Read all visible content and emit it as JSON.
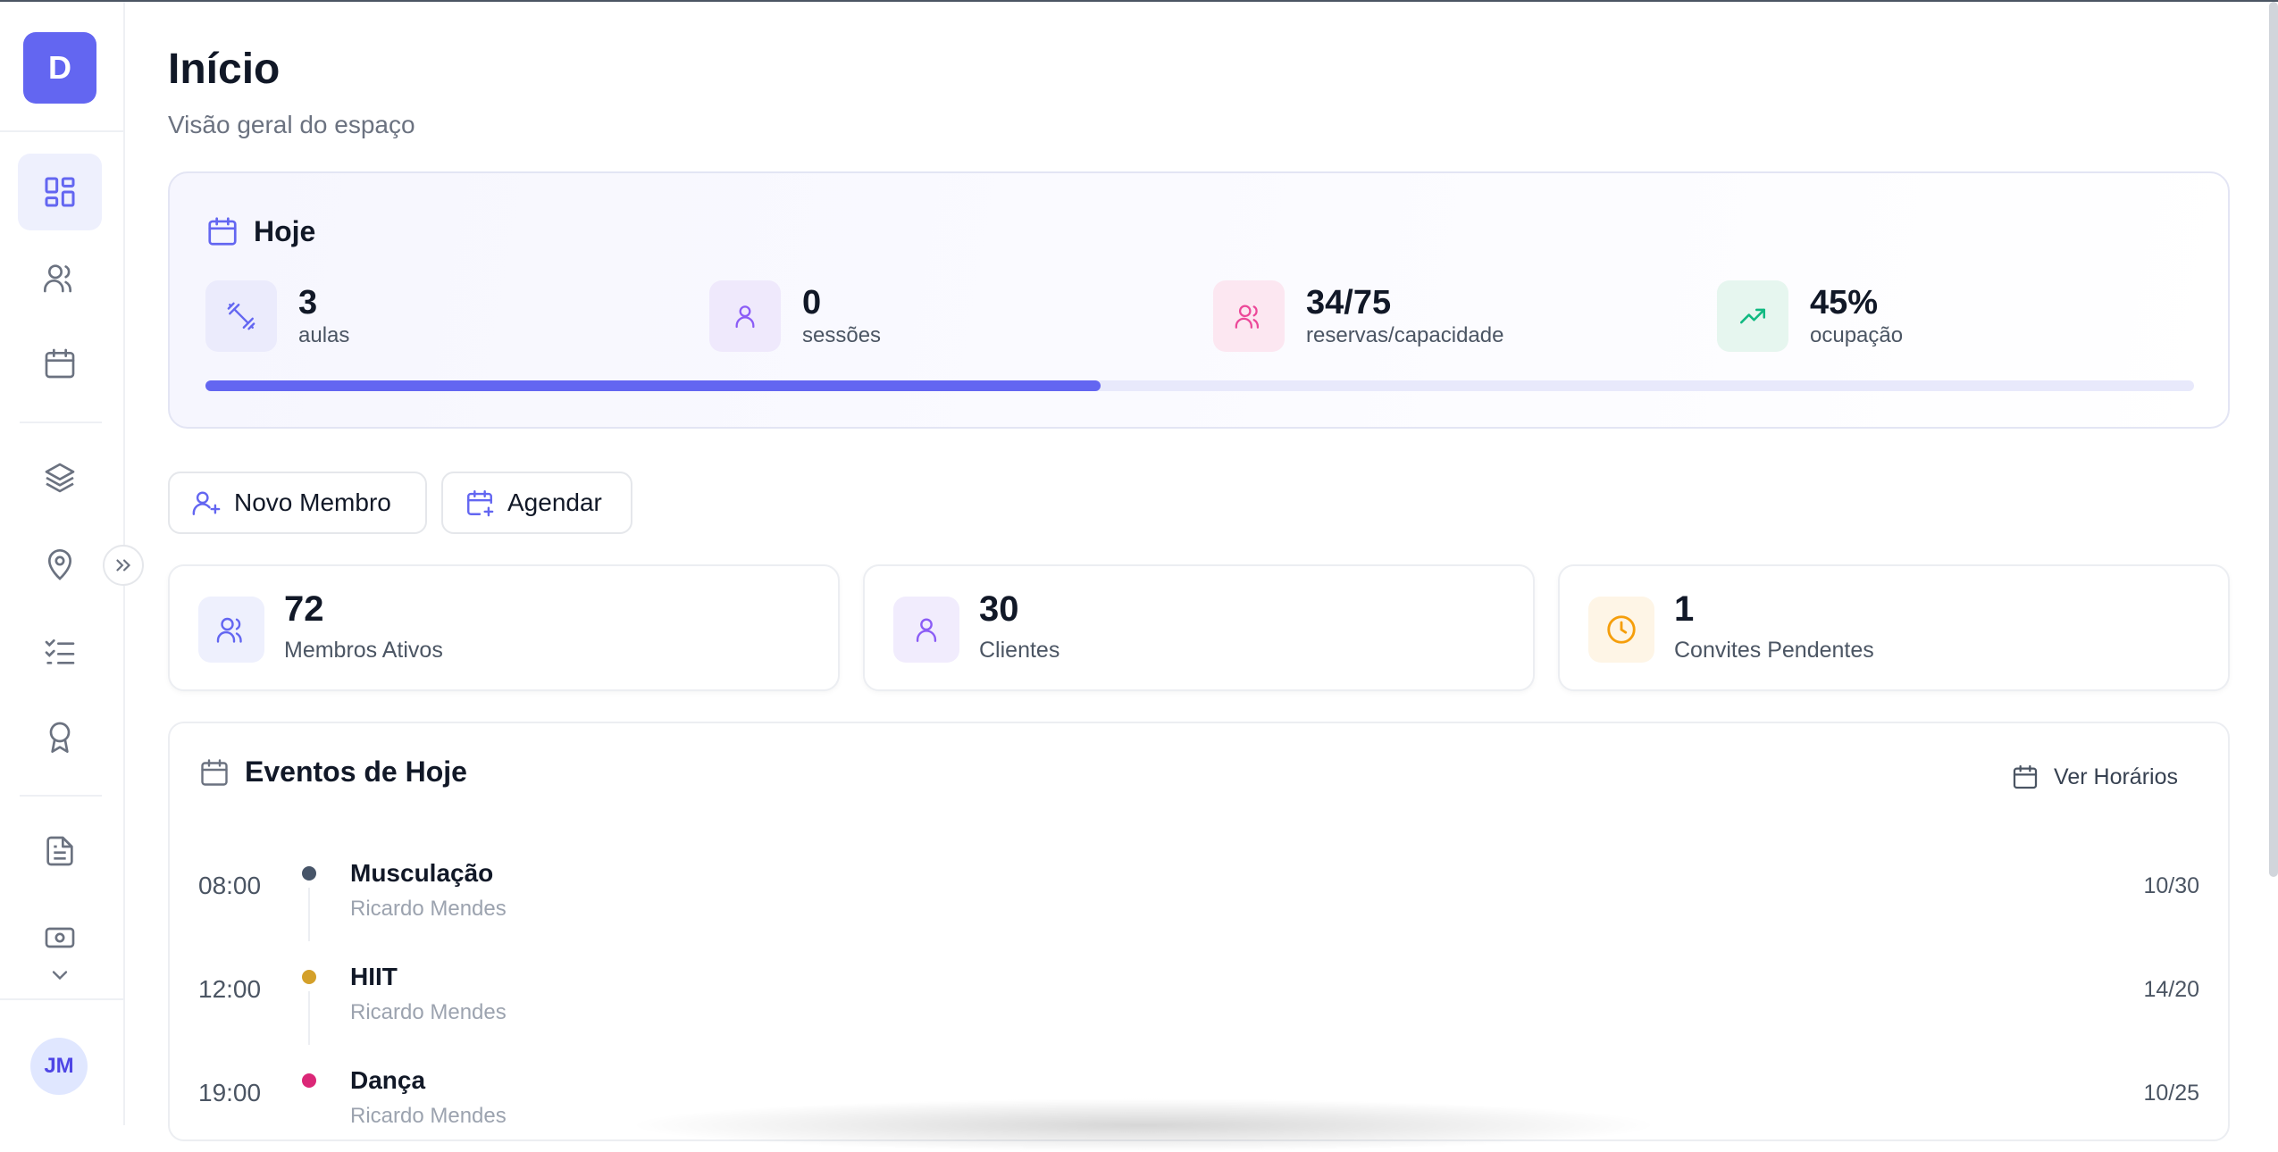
{
  "sidebar": {
    "logo_letter": "D",
    "items": [
      {
        "name": "dashboard",
        "icon": "dashboard-icon",
        "active": true
      },
      {
        "name": "members",
        "icon": "users-icon"
      },
      {
        "name": "schedule",
        "icon": "calendar-icon"
      },
      {
        "name": "plans",
        "icon": "layers-icon"
      },
      {
        "name": "locations",
        "icon": "map-pin-icon"
      },
      {
        "name": "tasks",
        "icon": "checklist-icon"
      },
      {
        "name": "achievements",
        "icon": "award-icon"
      },
      {
        "name": "documents",
        "icon": "file-text-icon"
      },
      {
        "name": "payments",
        "icon": "banknote-icon"
      }
    ],
    "user_initials": "JM"
  },
  "header": {
    "title": "Início",
    "subtitle": "Visão geral do espaço"
  },
  "today": {
    "title": "Hoje",
    "stats": [
      {
        "value": "3",
        "label": "aulas",
        "icon": "dumbbell-icon",
        "color": "#6366f1",
        "bg": "#ebebfc"
      },
      {
        "value": "0",
        "label": "sessões",
        "icon": "user-icon",
        "color": "#8b5cf6",
        "bg": "#efe9fc"
      },
      {
        "value": "34/75",
        "label": "reservas/capacidade",
        "icon": "users-icon",
        "color": "#ec4899",
        "bg": "#fce7f1"
      },
      {
        "value": "45%",
        "label": "ocupação",
        "icon": "trending-up-icon",
        "color": "#10b981",
        "bg": "#e6f6ef"
      }
    ],
    "progress_fraction": 0.45
  },
  "actions": {
    "new_member": "Novo Membro",
    "schedule": "Agendar"
  },
  "metrics": [
    {
      "value": "72",
      "label": "Membros Ativos",
      "icon": "users-icon",
      "color": "#6366f1",
      "bg": "#eef0fd"
    },
    {
      "value": "30",
      "label": "Clientes",
      "icon": "user-icon",
      "color": "#8b5cf6",
      "bg": "#f1ecfd"
    },
    {
      "value": "1",
      "label": "Convites Pendentes",
      "icon": "clock-icon",
      "color": "#f59e0b",
      "bg": "#fef5e6"
    }
  ],
  "events": {
    "title": "Eventos de Hoje",
    "view_schedule": "Ver Horários",
    "items": [
      {
        "time": "08:00",
        "name": "Musculação",
        "trainer": "Ricardo Mendes",
        "count": "10/30",
        "color": "#475569"
      },
      {
        "time": "12:00",
        "name": "HIIT",
        "trainer": "Ricardo Mendes",
        "count": "14/20",
        "color": "#d4a02a"
      },
      {
        "time": "19:00",
        "name": "Dança",
        "trainer": "Ricardo Mendes",
        "count": "10/25",
        "color": "#db2777"
      }
    ]
  },
  "colors": {
    "accent": "#6366f1"
  }
}
